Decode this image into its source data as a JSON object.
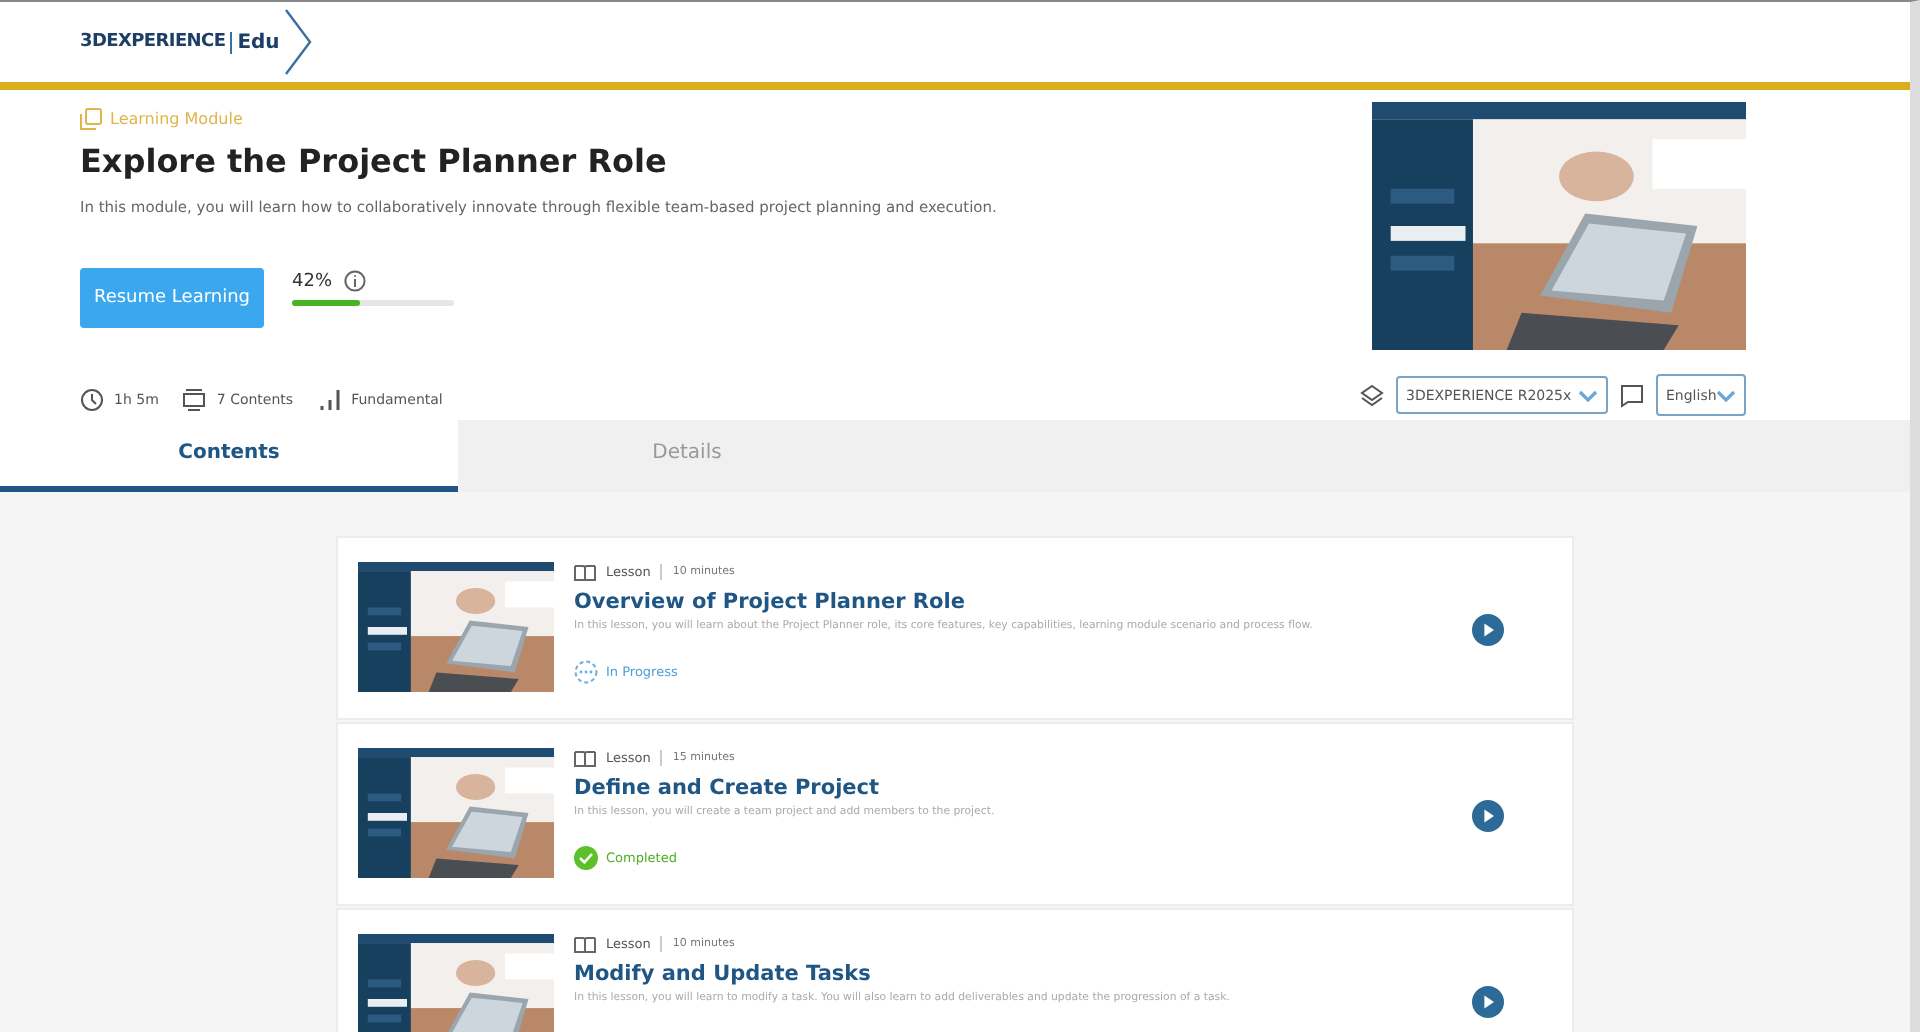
{
  "header": {
    "logo": {
      "brand": "3DEXPERIENCE",
      "edu": "Edu"
    }
  },
  "module": {
    "category": "Learning Module",
    "title": "Explore the Project Planner Role",
    "description": "In this module, you will learn how to collaboratively innovate through flexible team-based project planning and execution.",
    "resume_button": "Resume Learning",
    "progress": {
      "reading": "42%",
      "level": 0.42
    },
    "meta": [
      {
        "kind": "duration",
        "text": "1h 5m"
      },
      {
        "kind": "contents",
        "text": "7 Contents"
      },
      {
        "kind": "level",
        "text": "Fundamental"
      }
    ],
    "release_select": {
      "value": "3DEXPERIENCE R2025x"
    },
    "language_select": {
      "value": "English"
    }
  },
  "tabs": [
    {
      "label": "Contents",
      "selected": true
    },
    {
      "label": "Details",
      "selected": false
    }
  ],
  "lessons": [
    {
      "type": "Lesson",
      "duration": "10 minutes",
      "title": "Overview of Project Planner Role",
      "description": "In this lesson, you will learn about the Project Planner role, its core features, key capabilities, learning module scenario and process flow.",
      "status": {
        "kind": "in_progress",
        "label": "In Progress"
      }
    },
    {
      "type": "Lesson",
      "duration": "15 minutes",
      "title": "Define and Create Project",
      "description": "In this lesson, you will create a team project and add members to the project.",
      "status": {
        "kind": "completed",
        "label": "Completed"
      }
    },
    {
      "type": "Lesson",
      "duration": "10 minutes",
      "title": "Modify and Update Tasks",
      "description": "In this lesson, you will learn to modify a task. You will also learn to add deliverables and update the progression of a task."
    }
  ]
}
